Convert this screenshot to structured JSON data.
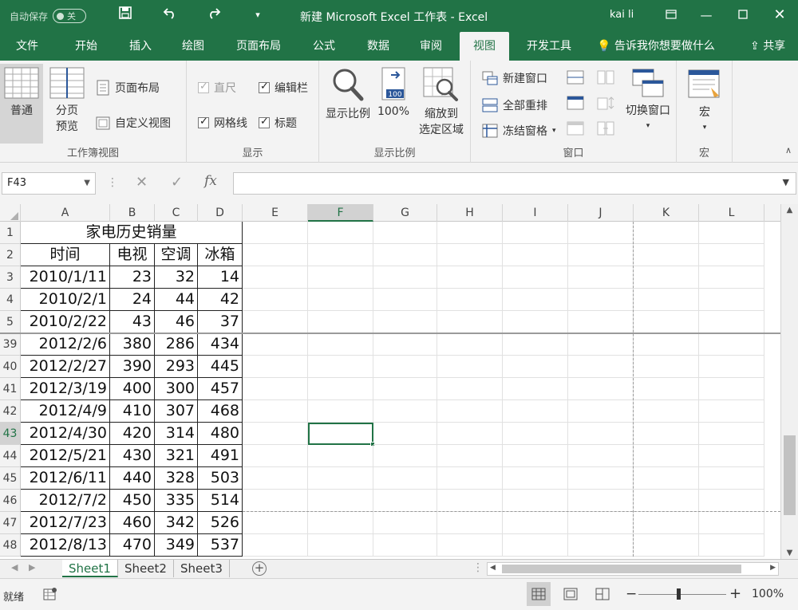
{
  "titlebar": {
    "autosave_label": "自动保存",
    "autosave_state": "关",
    "title": "新建 Microsoft Excel 工作表  -  Excel",
    "user": "kai li"
  },
  "tabs": [
    {
      "label": "文件"
    },
    {
      "label": "开始"
    },
    {
      "label": "插入"
    },
    {
      "label": "绘图"
    },
    {
      "label": "页面布局"
    },
    {
      "label": "公式"
    },
    {
      "label": "数据"
    },
    {
      "label": "审阅"
    },
    {
      "label": "视图",
      "active": true
    },
    {
      "label": "开发工具"
    }
  ],
  "tellme": "告诉我你想要做什么",
  "share": "共享",
  "ribbon": {
    "workbook_views": {
      "label": "工作簿视图",
      "normal": "普通",
      "page_break_1": "分页",
      "page_break_2": "预览",
      "page_layout": "页面布局",
      "custom_views": "自定义视图"
    },
    "show": {
      "label": "显示",
      "ruler": "直尺",
      "formula_bar": "编辑栏",
      "gridlines": "网格线",
      "headings": "标题"
    },
    "zoom": {
      "label": "显示比例",
      "zoom": "显示比例",
      "hundred": "100%",
      "hundred_icon": "100",
      "zoom_sel_1": "缩放到",
      "zoom_sel_2": "选定区域"
    },
    "window": {
      "label": "窗口",
      "new_window": "新建窗口",
      "arrange_all": "全部重排",
      "freeze_panes": "冻结窗格",
      "switch_windows": "切换窗口"
    },
    "macros": {
      "label": "宏",
      "macros": "宏"
    }
  },
  "formulabar": {
    "namebox": "F43",
    "fx": "fx",
    "value": ""
  },
  "columns": [
    "A",
    "B",
    "C",
    "D",
    "E",
    "F",
    "G",
    "H",
    "I",
    "J",
    "K",
    "L"
  ],
  "selected_column": "F",
  "sheet": {
    "title": "家电历史销量",
    "headers": [
      "时间",
      "电视",
      "空调",
      "冰箱"
    ],
    "rows": [
      {
        "row": "3",
        "date": "2010/1/11",
        "tv": "23",
        "ac": "32",
        "fridge": "14"
      },
      {
        "row": "4",
        "date": "2010/2/1",
        "tv": "24",
        "ac": "44",
        "fridge": "42"
      },
      {
        "row": "5",
        "date": "2010/2/22",
        "tv": "43",
        "ac": "46",
        "fridge": "37"
      },
      {
        "row": "39",
        "date": "2012/2/6",
        "tv": "380",
        "ac": "286",
        "fridge": "434"
      },
      {
        "row": "40",
        "date": "2012/2/27",
        "tv": "390",
        "ac": "293",
        "fridge": "445"
      },
      {
        "row": "41",
        "date": "2012/3/19",
        "tv": "400",
        "ac": "300",
        "fridge": "457"
      },
      {
        "row": "42",
        "date": "2012/4/9",
        "tv": "410",
        "ac": "307",
        "fridge": "468"
      },
      {
        "row": "43",
        "date": "2012/4/30",
        "tv": "420",
        "ac": "314",
        "fridge": "480"
      },
      {
        "row": "44",
        "date": "2012/5/21",
        "tv": "430",
        "ac": "321",
        "fridge": "491"
      },
      {
        "row": "45",
        "date": "2012/6/11",
        "tv": "440",
        "ac": "328",
        "fridge": "503"
      },
      {
        "row": "46",
        "date": "2012/7/2",
        "tv": "450",
        "ac": "335",
        "fridge": "514"
      },
      {
        "row": "47",
        "date": "2012/7/23",
        "tv": "460",
        "ac": "342",
        "fridge": "526"
      },
      {
        "row": "48",
        "date": "2012/8/13",
        "tv": "470",
        "ac": "349",
        "fridge": "537"
      }
    ],
    "header_rows": [
      "1",
      "2"
    ],
    "selected_row": "43"
  },
  "sheet_tabs": [
    {
      "label": "Sheet1",
      "active": true
    },
    {
      "label": "Sheet2"
    },
    {
      "label": "Sheet3"
    }
  ],
  "status": {
    "text": "就绪",
    "zoom": "100%"
  },
  "colors": {
    "accent": "#217346",
    "ribbon": "#f3f3f3"
  }
}
